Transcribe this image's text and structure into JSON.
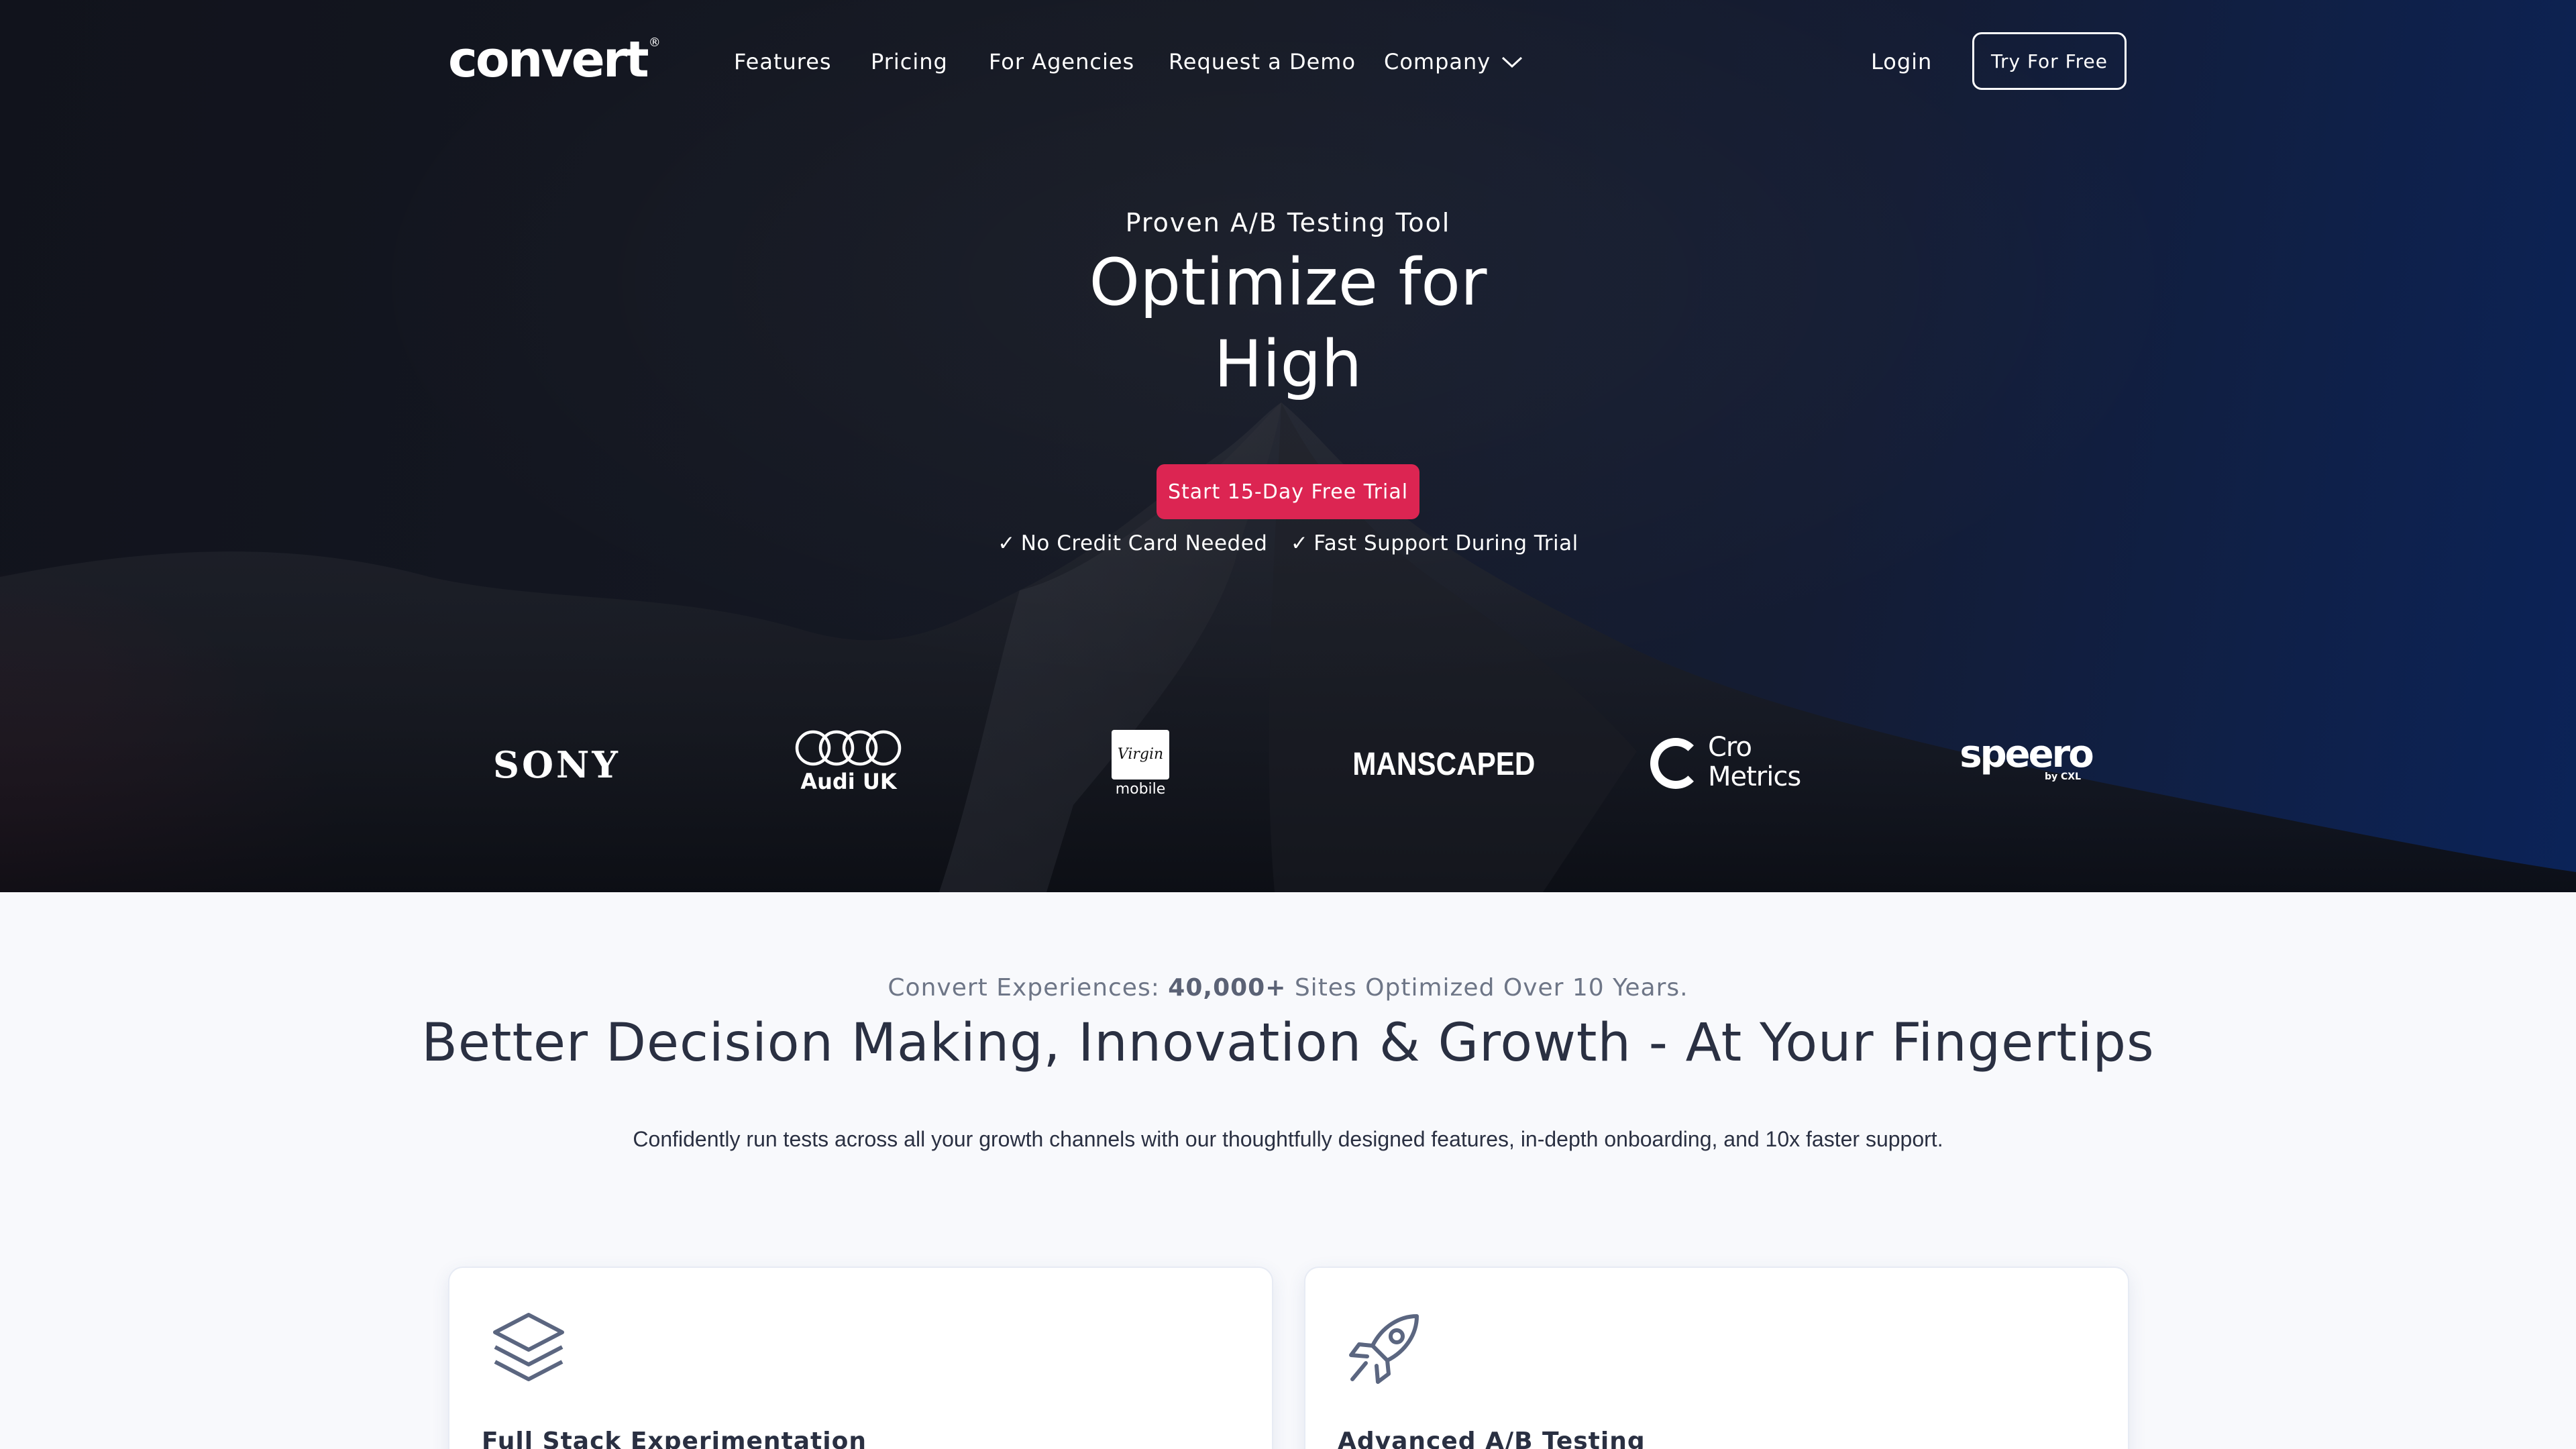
{
  "nav": {
    "logo": "convert",
    "logo_mark": "®",
    "links": [
      "Features",
      "Pricing",
      "For Agencies",
      "Request a Demo",
      "Company"
    ],
    "login": "Login",
    "try_free": "Try For Free"
  },
  "hero": {
    "eyebrow": "Proven A/B Testing Tool",
    "headline_line1": "Optimize for",
    "headline_line2": "High",
    "cta": "Start 15-Day Free Trial",
    "perk_check": "✓",
    "perks": [
      "No Credit Card Needed",
      "Fast Support During Trial"
    ]
  },
  "logos": {
    "sony": "SONY",
    "audi": "Audi UK",
    "virgin": "Virgin",
    "virgin_sub": "mobile",
    "manscaped": "MANSCAPED",
    "cro_line1": "Cro",
    "cro_line2": "Metrics",
    "speero": "speero",
    "speero_sub": "by CXL"
  },
  "features": {
    "eyebrow_prefix": "Convert Experiences: ",
    "eyebrow_highlight": "40,000+",
    "eyebrow_suffix": " Sites Optimized Over 10 Years.",
    "title": "Better Decision Making, Innovation & Growth - At Your Fingertips",
    "description": "Confidently run tests across all your growth channels with our thoughtfully designed features, in-depth onboarding, and 10x faster support.",
    "cards": [
      {
        "title": "Full Stack Experimentation",
        "icon": "layers-icon"
      },
      {
        "title": "Advanced A/B Testing",
        "icon": "rocket-icon"
      }
    ]
  },
  "colors": {
    "cta": "#dc2552",
    "text_dark": "#2a3042",
    "icon": "#5b6680"
  }
}
